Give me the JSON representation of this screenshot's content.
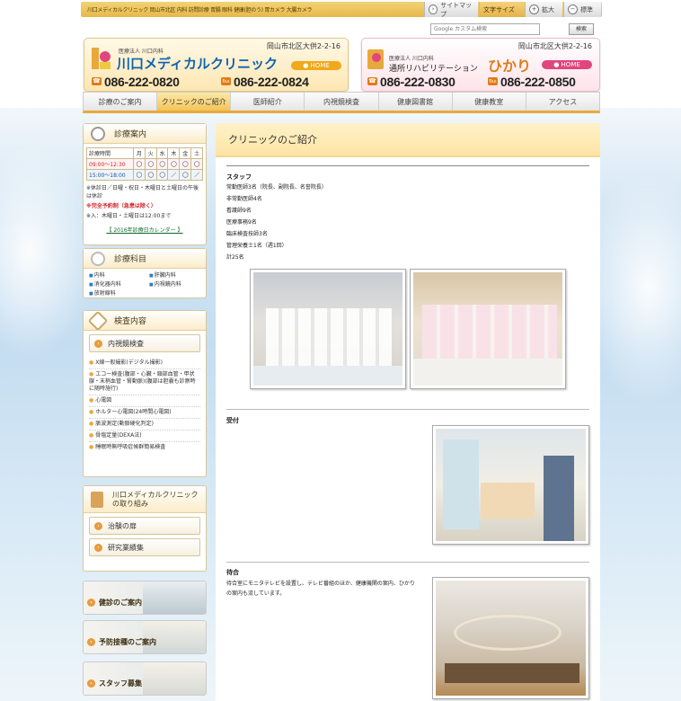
{
  "topbar": {
    "links": "川口メディカルクリニック 岡山市北区 内科 訪問診療 胃腸 眼科 健康(胆のう) 胃カメラ 大腸カメラ",
    "sitemap": "サイトマップ",
    "textsize": "文字サイズ",
    "zoom_in": "拡大",
    "standard": "標準"
  },
  "search": {
    "placeholder": "Google カスタム検索",
    "button": "検索"
  },
  "header_left": {
    "corp": "医療法人 川口内科",
    "name": "川口メディカルクリニック",
    "address": "岡山市北区大供2-2-16",
    "home": "HOME",
    "tel1": "086-222-0820",
    "tel2": "086-222-0824"
  },
  "header_right": {
    "corp": "医療法人 川口内科",
    "name": "通所リハビリテーション",
    "name2": "ひかり",
    "address": "岡山市北区大供2-2-16",
    "home": "HOME",
    "tel1": "086-222-0830",
    "tel2": "086-222-0850"
  },
  "nav": [
    "診療のご案内",
    "クリニックのご紹介",
    "医師紹介",
    "内視鏡検査",
    "健康図書館",
    "健康教室",
    "アクセス"
  ],
  "sidebar": {
    "hours_title": "診療案内",
    "hours_header": [
      "診療時間",
      "月",
      "火",
      "水",
      "木",
      "金",
      "土"
    ],
    "hours_rows": [
      {
        "time": "09:00～12:30",
        "cells": [
          "◯",
          "◯",
          "◯",
          "◯",
          "◯",
          "◯"
        ]
      },
      {
        "time": "15:00～18:00",
        "cells": [
          "◯",
          "◯",
          "◯",
          "／",
          "◯",
          "／"
        ]
      }
    ],
    "note1": "※休診日／日曜・祝日・木曜日と土曜日の午後は休診",
    "note2": "※完全予約制（急患は除く）",
    "note3": "※入：木曜日・土曜日は12:00まで",
    "calendar": "【 2016年診療日カレンダー 】",
    "dept_title": "診療科目",
    "depts": [
      "内科",
      "肝臓内科",
      "消化器内科",
      "内視鏡内科",
      "放射線科"
    ],
    "exam_title": "検査内容",
    "exam_button": "内視鏡検査",
    "exams": [
      "X線一般撮影(デジタル撮影)",
      "エコー検査(腹部・心臓・頸部血管・甲状腺・末梢血管・腎動脈)(腹部は胆嚢も診察時に随時施行)",
      "心電図",
      "ホルター心電図(24時間心電図)",
      "脈波測定(動脈硬化判定)",
      "骨塩定量(DEXA法)",
      "睡眠時無呼吸症候群簡易検査"
    ],
    "effort_title": "川口メディカルクリニックの取り組み",
    "effort_buttons": [
      "治験の扉",
      "研究業績集"
    ],
    "banners": [
      "健診のご案内",
      "予防接種のご案内",
      "スタッフ募集"
    ]
  },
  "main": {
    "title": "クリニックのご紹介",
    "staff_heading": "スタッフ",
    "staff": [
      "常勤医師3名（院長、副院長、名誉院長）",
      "非常勤医師4名",
      "看護師9名",
      "医療事務9名",
      "臨床検査技師3名",
      "管理栄養士1名（週1回）",
      "計25名"
    ],
    "reception_heading": "受付",
    "waiting_heading": "待合",
    "waiting_text": "待合室にモニタテレビを設置し、テレビ番組のほか、健康機関の案内、ひかりの案内も流しています。"
  },
  "colors": {
    "accent": "#e8a93b",
    "brand_blue": "#0f63b0",
    "home_green": "#f0a91a",
    "home_pink": "#e0467c"
  }
}
